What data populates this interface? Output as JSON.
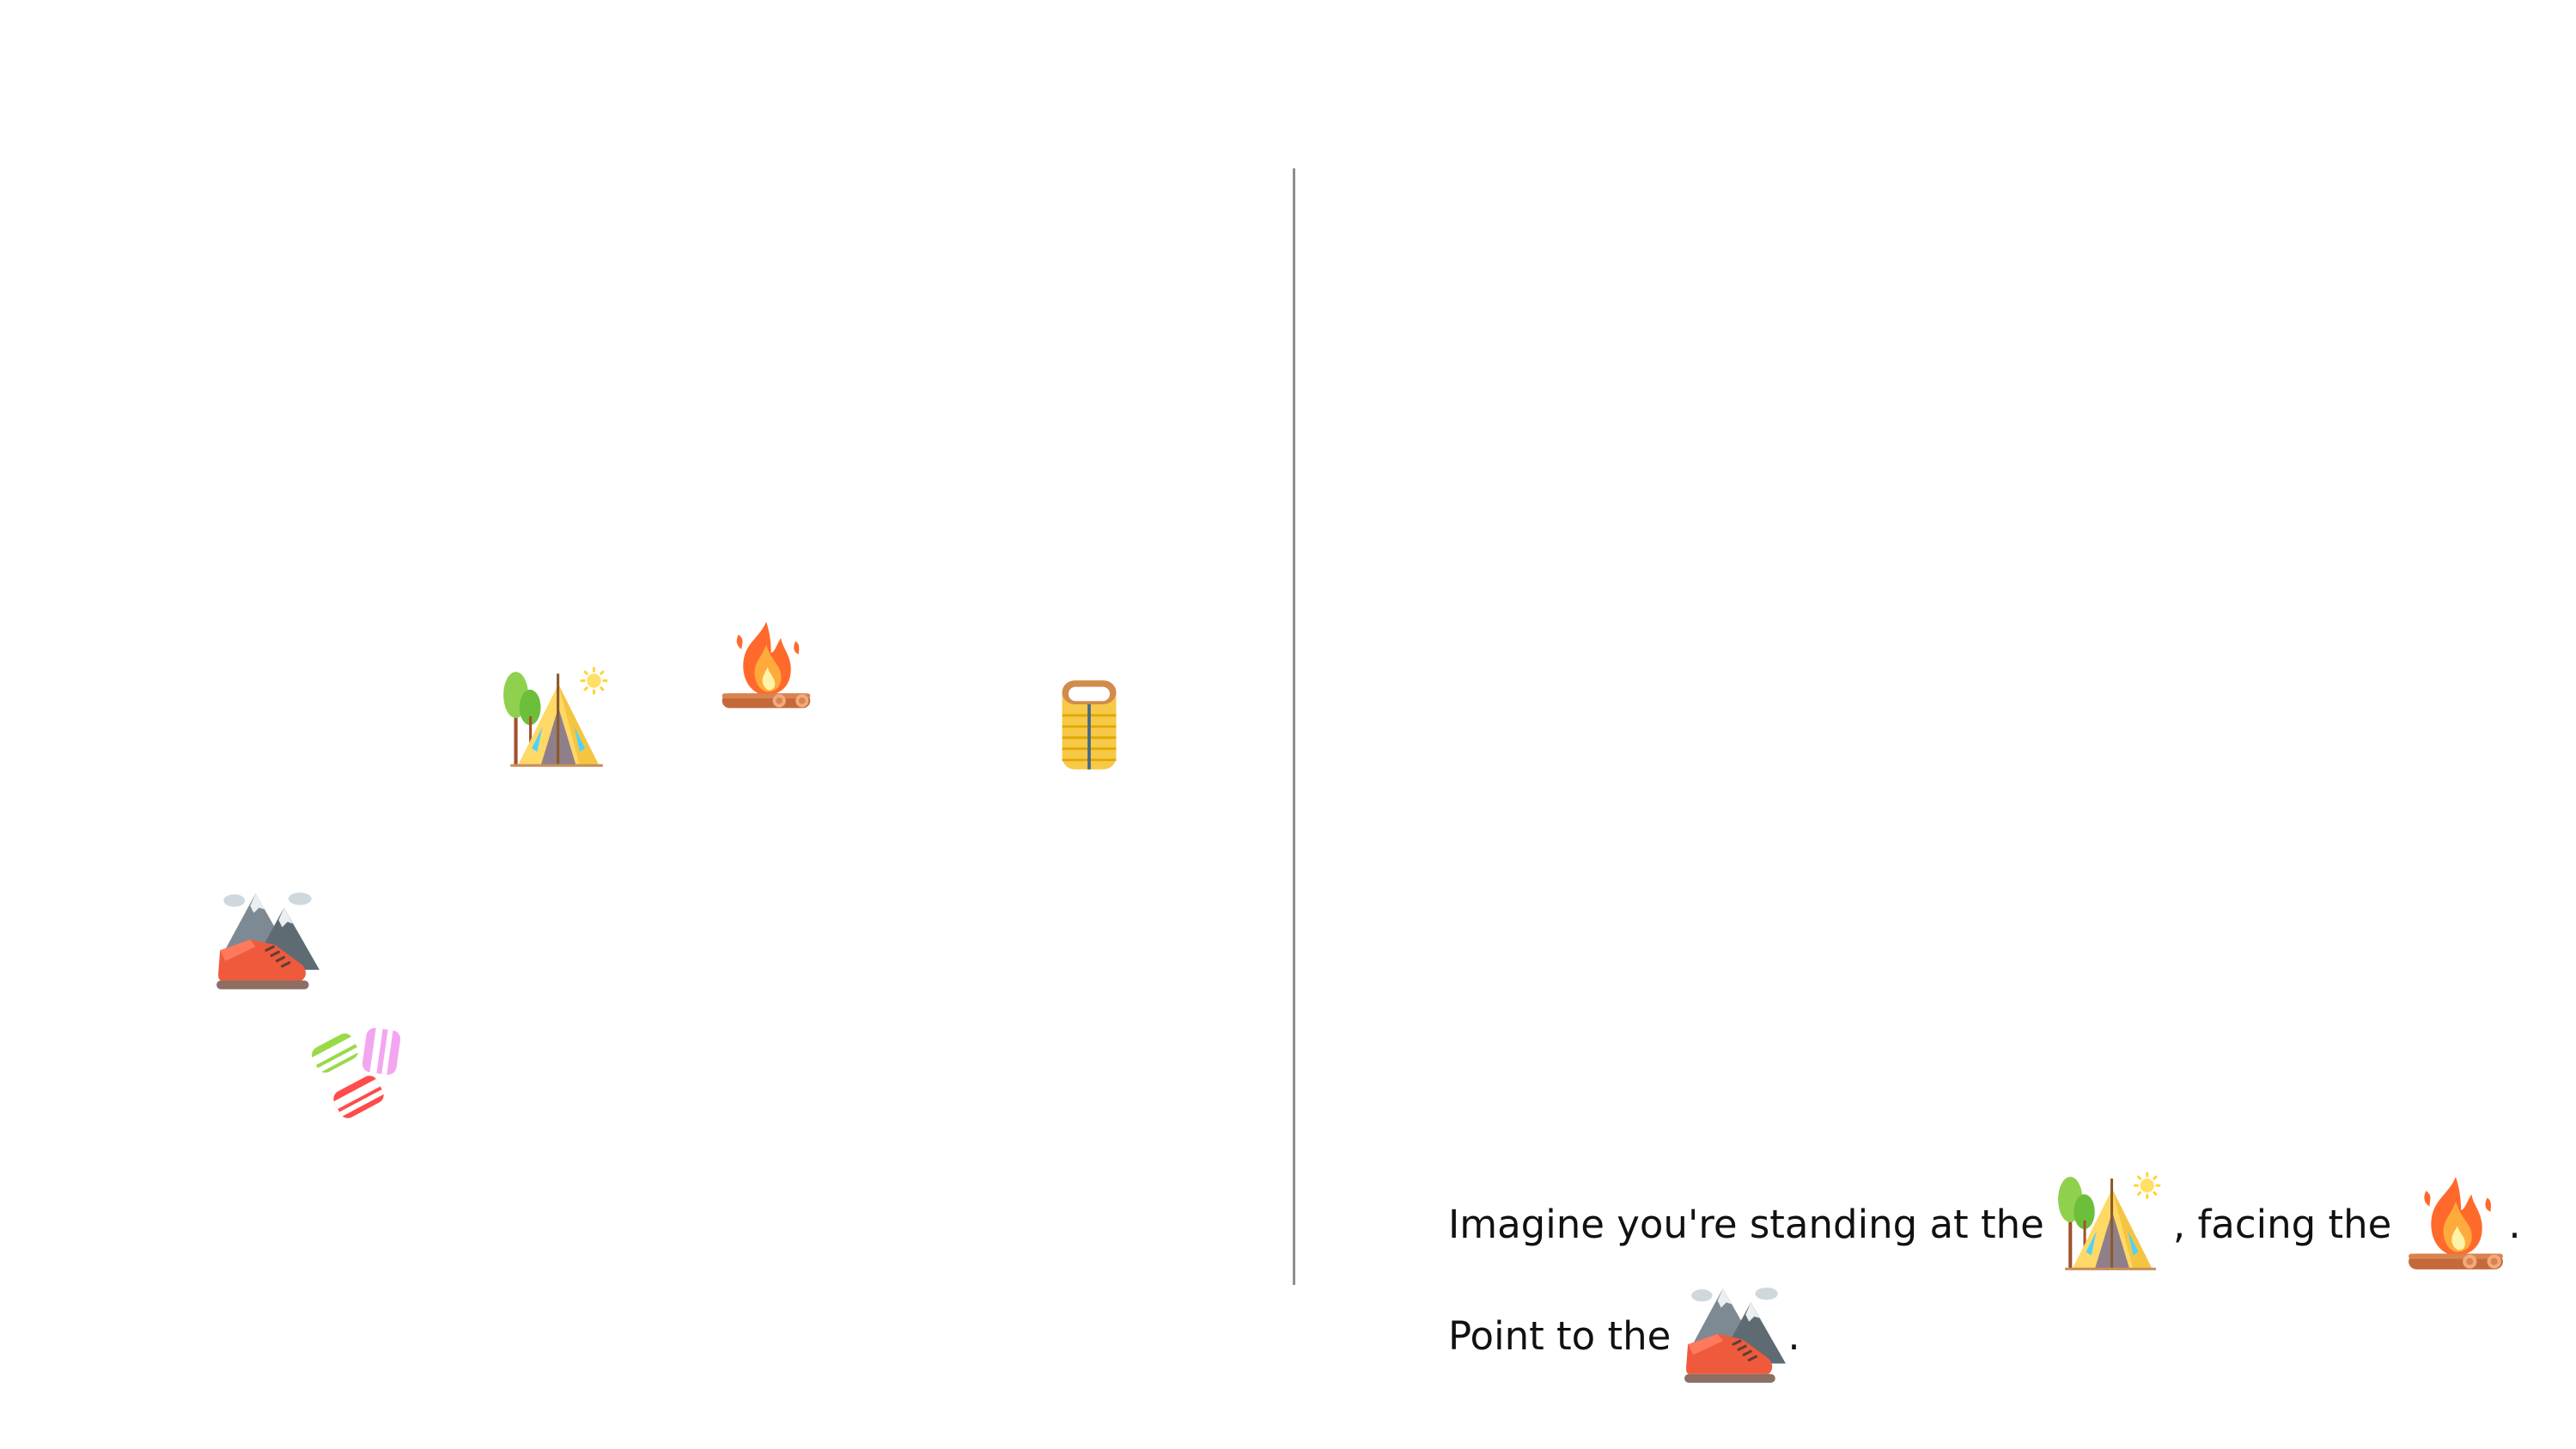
{
  "scene": {
    "objects": [
      {
        "id": "tent",
        "icon": "tent-icon"
      },
      {
        "id": "campfire",
        "icon": "campfire-icon"
      },
      {
        "id": "sleeping-bag",
        "icon": "sleeping-bag-icon"
      },
      {
        "id": "hiking-boot",
        "icon": "hiking-boot-icon"
      },
      {
        "id": "marshmallows",
        "icon": "marshmallows-icon"
      }
    ]
  },
  "prompt": {
    "line1_a": "Imagine you're standing at the",
    "line1_b": ", facing the",
    "line1_c": ".",
    "line2_a": "Point to the",
    "line2_b": ".",
    "standing_at": "tent-icon",
    "facing": "campfire-icon",
    "target": "hiking-boot-icon"
  },
  "colors": {
    "divider": "#8e8e8e",
    "text": "#111111"
  }
}
